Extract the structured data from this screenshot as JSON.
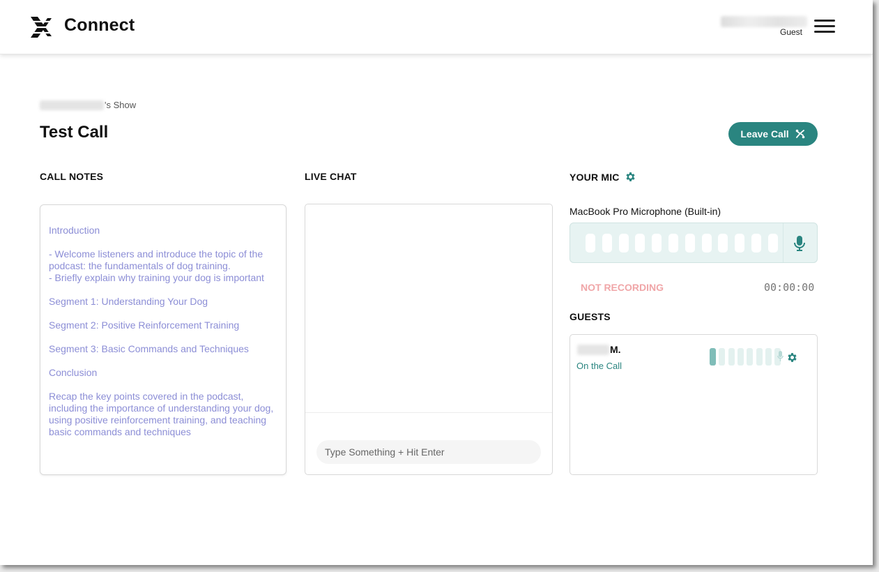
{
  "header": {
    "brand": "Connect",
    "user_role": "Guest"
  },
  "page": {
    "show_suffix": "'s Show",
    "title": "Test Call",
    "leave_button": "Leave Call"
  },
  "sections": {
    "call_notes": "CALL NOTES",
    "live_chat": "LIVE CHAT",
    "your_mic": "YOUR MIC",
    "guests": "GUESTS"
  },
  "notes": {
    "text": "Introduction\n\n- Welcome listeners and introduce the topic of the podcast: the fundamentals of dog training.\n- Briefly explain why training your dog is important\n\nSegment 1: Understanding Your Dog\n\nSegment 2: Positive Reinforcement Training\n\nSegment 3: Basic Commands and Techniques\n\nConclusion\n\nRecap the key points covered in the podcast, including the importance of understanding your dog, using positive reinforcement training, and teaching basic commands and techniques"
  },
  "chat": {
    "placeholder": "Type Something + Hit Enter"
  },
  "mic": {
    "device": "MacBook Pro Microphone (Built-in)",
    "status": "NOT RECORDING",
    "timer": "00:00:00",
    "level": 0
  },
  "guests": [
    {
      "name_suffix": "M.",
      "status": "On the Call",
      "level": 0.15
    }
  ],
  "colors": {
    "accent": "#2a8580",
    "notes_text": "#8c8ed6",
    "not_recording": "#f0a6a8",
    "meter_bg": "#e7f3f2"
  },
  "icons": {
    "logo": "connect-logo-icon",
    "menu": "hamburger-menu-icon",
    "leave": "phone-hangup-icon",
    "settings": "gear-icon",
    "mic": "microphone-icon"
  }
}
